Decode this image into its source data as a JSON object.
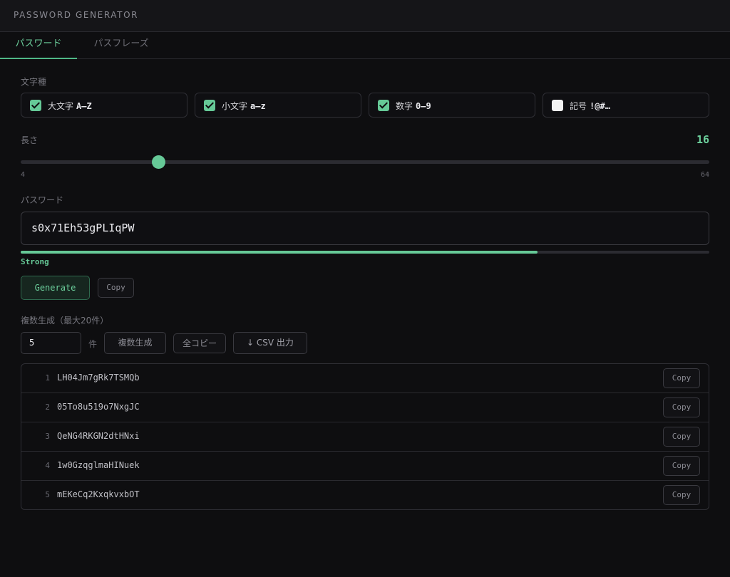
{
  "app": {
    "title": "PASSWORD GENERATOR"
  },
  "tabs": [
    {
      "label": "パスワード",
      "active": true
    },
    {
      "label": "パスフレーズ",
      "active": false
    }
  ],
  "charset": {
    "label": "文字種",
    "options": [
      {
        "label": "大文字",
        "code": "A–Z",
        "checked": true
      },
      {
        "label": "小文字",
        "code": "a–z",
        "checked": true
      },
      {
        "label": "数字",
        "code": "0–9",
        "checked": true
      },
      {
        "label": "記号",
        "code": "!@#…",
        "checked": false
      }
    ]
  },
  "length": {
    "label": "長さ",
    "value": "16",
    "min": "4",
    "max": "64"
  },
  "password": {
    "label": "パスワード",
    "value": "s0x71Eh53gPLIqPW",
    "strength": "Strong",
    "strength_fraction": 0.75
  },
  "actions": {
    "generate": "Generate",
    "copy": "Copy"
  },
  "bulk": {
    "label": "複数生成（最大20件）",
    "count": "5",
    "unit": "件",
    "generate": "複数生成",
    "copy_all": "全コピー",
    "csv": "↓ CSV 出力"
  },
  "results": [
    {
      "index": "1",
      "value": "LH04Jm7gRk7TSMQb",
      "copy": "Copy"
    },
    {
      "index": "2",
      "value": "05To8u519o7NxgJC",
      "copy": "Copy"
    },
    {
      "index": "3",
      "value": "QeNG4RKGN2dtHNxi",
      "copy": "Copy"
    },
    {
      "index": "4",
      "value": "1w0GzqglmaHINuek",
      "copy": "Copy"
    },
    {
      "index": "5",
      "value": "mEKeCq2KxqkvxbOT",
      "copy": "Copy"
    }
  ],
  "colors": {
    "accent": "#66c997",
    "background": "#0e0e10"
  }
}
